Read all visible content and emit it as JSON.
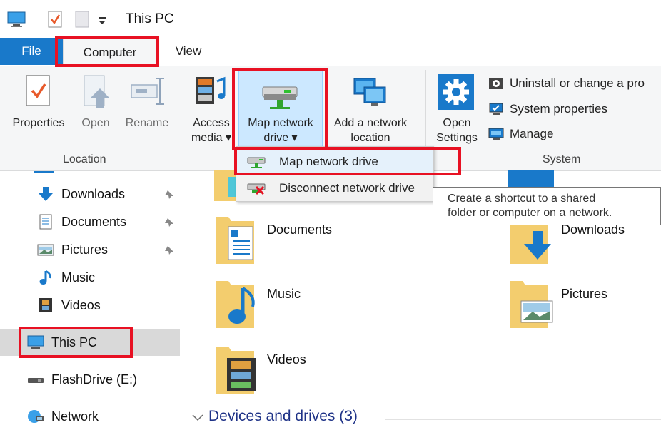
{
  "window": {
    "title": "This PC"
  },
  "tabs": {
    "file": "File",
    "computer": "Computer",
    "view": "View"
  },
  "ribbon": {
    "location": {
      "label": "Location",
      "properties": "Properties",
      "open": "Open",
      "rename": "Rename"
    },
    "network": {
      "access_media_1": "Access",
      "access_media_2": "media ▾",
      "map_drive_1": "Map network",
      "map_drive_2": "drive ▾",
      "add_location_1": "Add a network",
      "add_location_2": "location"
    },
    "system": {
      "label": "System",
      "open_settings_1": "Open",
      "open_settings_2": "Settings",
      "uninstall": "Uninstall or change a pro",
      "system_properties": "System properties",
      "manage": "Manage"
    }
  },
  "dropdown": {
    "map_drive": "Map network drive",
    "disconnect": "Disconnect network drive"
  },
  "tooltip": {
    "line1": "Create a shortcut to a shared",
    "line2": "folder or computer on a network."
  },
  "nav": {
    "downloads": "Downloads",
    "documents": "Documents",
    "pictures": "Pictures",
    "music": "Music",
    "videos": "Videos",
    "this_pc": "This PC",
    "flashdrive": "FlashDrive (E:)",
    "network": "Network"
  },
  "folders": {
    "documents": "Documents",
    "downloads": "Downloads",
    "music": "Music",
    "pictures": "Pictures",
    "videos": "Videos"
  },
  "devices_header": "Devices and drives (3)",
  "colors": {
    "accent": "#1979ca",
    "highlight": "#e81123",
    "folder": "#f3cd6e",
    "section_header": "#1e3287"
  }
}
